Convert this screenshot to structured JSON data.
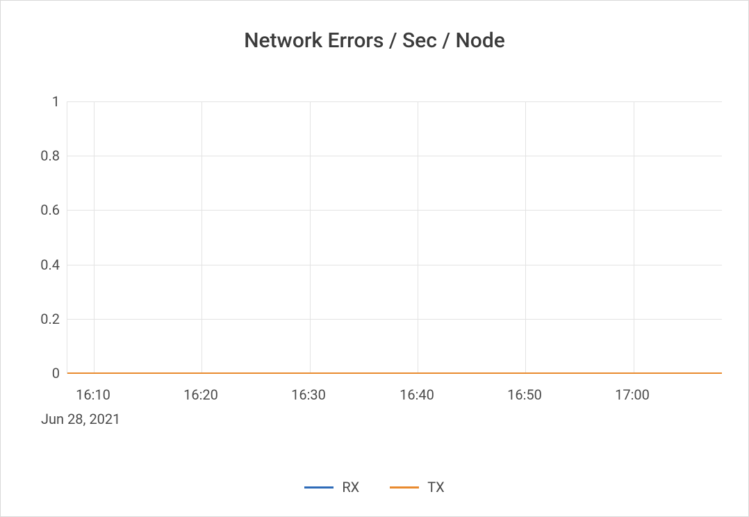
{
  "chart_data": {
    "type": "line",
    "title": "Network Errors / Sec / Node",
    "xlabel": "",
    "ylabel": "",
    "ylim": [
      0,
      1
    ],
    "y_ticks": [
      0,
      0.2,
      0.4,
      0.6,
      0.8,
      1
    ],
    "x_ticks": [
      "16:10",
      "16:20",
      "16:30",
      "16:40",
      "16:50",
      "17:00"
    ],
    "x_date": "Jun 28, 2021",
    "series": [
      {
        "name": "RX",
        "color": "#2e6bb8",
        "values": [
          0,
          0,
          0,
          0,
          0,
          0
        ]
      },
      {
        "name": "TX",
        "color": "#e98a2e",
        "values": [
          0,
          0,
          0,
          0,
          0,
          0
        ]
      }
    ],
    "categories": [
      "16:10",
      "16:20",
      "16:30",
      "16:40",
      "16:50",
      "17:00"
    ]
  }
}
